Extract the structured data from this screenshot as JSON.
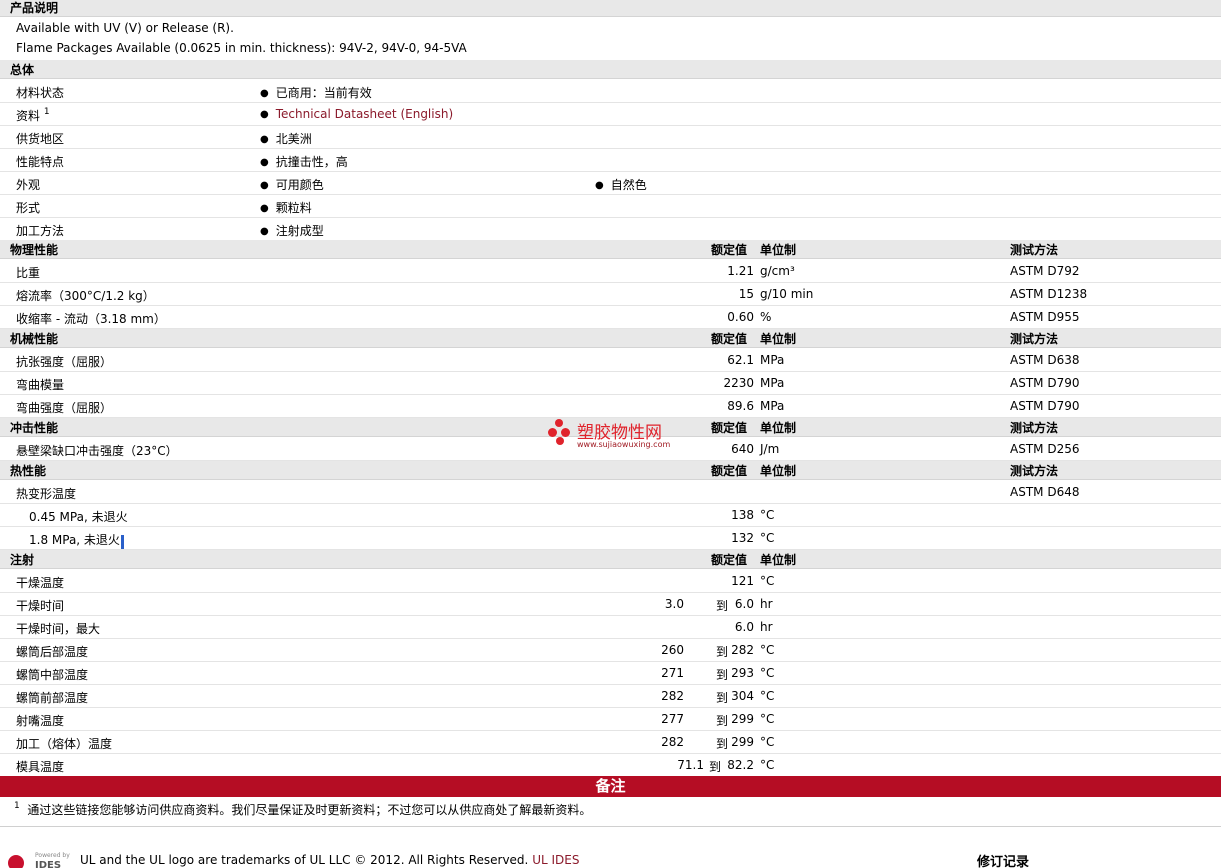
{
  "product_desc": {
    "heading": "产品说明",
    "line1": "Available with UV (V) or Release (R).",
    "line2": "Flame Packages Available (0.0625 in min. thickness): 94V-2, 94V-0, 94-5VA"
  },
  "general": {
    "heading": "总体",
    "rows": [
      {
        "label": "材料状态",
        "value": "已商用：当前有效"
      },
      {
        "label": "资料",
        "sup": "1",
        "value": "Technical Datasheet (English)"
      },
      {
        "label": "供货地区",
        "value": "北美洲"
      },
      {
        "label": "性能特点",
        "value": "抗撞击性，高"
      },
      {
        "label": "外观",
        "value": "可用颜色",
        "value2": "自然色"
      },
      {
        "label": "形式",
        "value": "颗粒料"
      },
      {
        "label": "加工方法",
        "value": "注射成型"
      }
    ]
  },
  "columns": {
    "nominal": "额定值",
    "unit": "单位制",
    "method": "测试方法"
  },
  "physical": {
    "heading": "物理性能",
    "rows": [
      {
        "label": "比重",
        "value": "1.21",
        "unit": "g/cm³",
        "method": "ASTM D792"
      },
      {
        "label": "熔流率（300°C/1.2 kg）",
        "value": "15",
        "unit": "g/10 min",
        "method": "ASTM D1238"
      },
      {
        "label": "收缩率 - 流动（3.18 mm）",
        "value": "0.60",
        "unit": "%",
        "method": "ASTM D955"
      }
    ]
  },
  "mechanical": {
    "heading": "机械性能",
    "rows": [
      {
        "label": "抗张强度（屈服）",
        "value": "62.1",
        "unit": "MPa",
        "method": "ASTM D638"
      },
      {
        "label": "弯曲模量",
        "value": "2230",
        "unit": "MPa",
        "method": "ASTM D790"
      },
      {
        "label": "弯曲强度（屈服）",
        "value": "89.6",
        "unit": "MPa",
        "method": "ASTM D790"
      }
    ]
  },
  "impact": {
    "heading": "冲击性能",
    "rows": [
      {
        "label": "悬壁梁缺口冲击强度（23°C）",
        "value": "640",
        "unit": "J/m",
        "method": "ASTM D256"
      }
    ]
  },
  "thermal": {
    "heading": "热性能",
    "rows": [
      {
        "label": "热变形温度",
        "value": "",
        "unit": "",
        "method": "ASTM D648"
      },
      {
        "label": "0.45 MPa, 未退火",
        "value": "138",
        "unit": "°C",
        "method": ""
      },
      {
        "label": "1.8 MPa, 未退火",
        "value": "132",
        "unit": "°C",
        "method": ""
      }
    ]
  },
  "injection": {
    "heading": "注射",
    "rows": [
      {
        "label": "干燥温度",
        "value": "121",
        "unit": "°C"
      },
      {
        "label": "干燥时间",
        "from": "3.0",
        "to": "6.0",
        "unit": "hr"
      },
      {
        "label": "干燥时间，最大",
        "value": "6.0",
        "unit": "hr"
      },
      {
        "label": "螺筒后部温度",
        "from": "260",
        "to": "282",
        "unit": "°C"
      },
      {
        "label": "螺筒中部温度",
        "from": "271",
        "to": "293",
        "unit": "°C"
      },
      {
        "label": "螺筒前部温度",
        "from": "282",
        "to": "304",
        "unit": "°C"
      },
      {
        "label": "射嘴温度",
        "from": "277",
        "to": "299",
        "unit": "°C"
      },
      {
        "label": "加工（熔体）温度",
        "from": "282",
        "to": "299",
        "unit": "°C"
      },
      {
        "label": "模具温度",
        "from": "71.1",
        "to": "82.2",
        "unit": "°C"
      }
    ],
    "range_word": "到"
  },
  "notes": {
    "heading": "备注",
    "sup": "1",
    "text": "通过这些链接您能够访问供应商资料。我们尽量保证及时更新资料；不过您可以从供应商处了解最新资料。"
  },
  "footer": {
    "powered_by": "Powered by",
    "ides": "IDES",
    "trademark": "UL and the UL logo are trademarks of UL LLC © 2012. All Rights Reserved.",
    "ul_ides_link": "UL IDES",
    "revision": "修订记录"
  },
  "watermark": {
    "name": "塑胶物性网",
    "url": "www.sujiaowuxing.com"
  }
}
